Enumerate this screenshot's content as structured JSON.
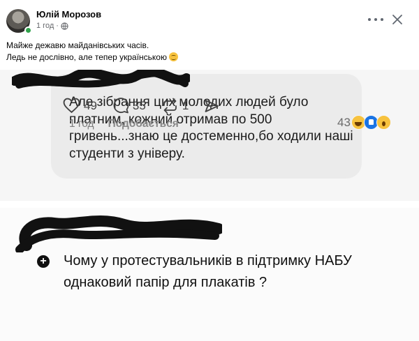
{
  "post": {
    "author": "Юлій Морозов",
    "time": "1 год",
    "separator": "·",
    "text_line1": "Майже дежавю майданівських часів.",
    "text_line2": "Ледь не дослівно, але тепер українською"
  },
  "comment": {
    "text": "Але зібрання цих молодих людей було платним, кожний отримав по 500 гривень...знаю це достеменно,бо ходили наші студенти з універу.",
    "time": "1 год",
    "like_label": "Подобається",
    "reaction_count": "43",
    "reactions": [
      "laugh",
      "like",
      "wow"
    ]
  },
  "thread": {
    "text": "Чому у протестувальників в підтримку НАБУ однаковий папір для плакатів ?",
    "likes": "49",
    "replies": "35",
    "reposts": "1"
  },
  "colors": {
    "online": "#31a24c",
    "like_reaction": "#1b74e4",
    "emoji": "#f7c23e"
  }
}
